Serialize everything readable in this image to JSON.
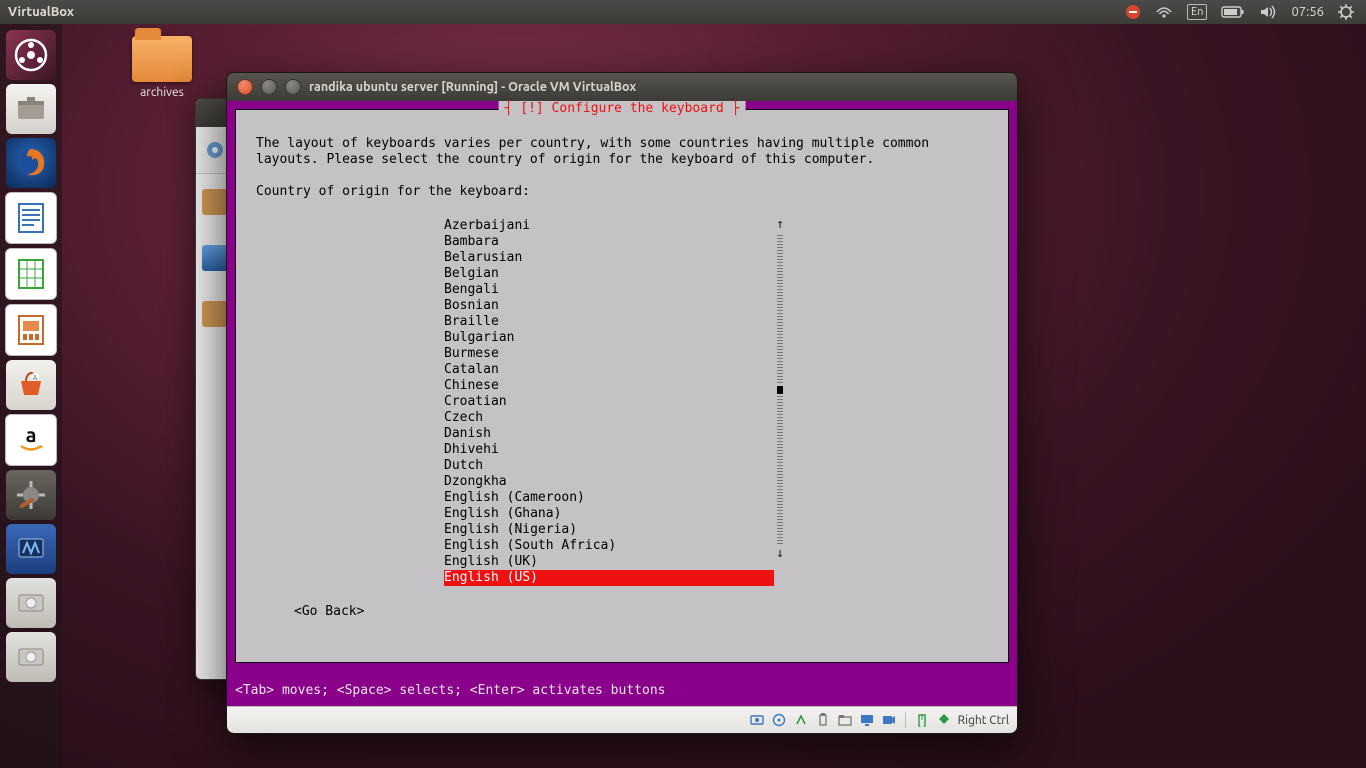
{
  "topbar": {
    "app_title": "VirtualBox",
    "lang": "En",
    "clock": "07:56"
  },
  "desktop": {
    "folder_label": "archives"
  },
  "vm_window": {
    "title": "randika ubuntu server [Running] - Oracle VM VirtualBox",
    "host_key": "Right Ctrl"
  },
  "installer": {
    "dialog_title": "[!] Configure the keyboard",
    "intro": "The layout of keyboards varies per country, with some countries having multiple common\nlayouts. Please select the country of origin for the keyboard of this computer.",
    "prompt": "Country of origin for the keyboard:",
    "items": [
      "Azerbaijani",
      "Bambara",
      "Belarusian",
      "Belgian",
      "Bengali",
      "Bosnian",
      "Braille",
      "Bulgarian",
      "Burmese",
      "Catalan",
      "Chinese",
      "Croatian",
      "Czech",
      "Danish",
      "Dhivehi",
      "Dutch",
      "Dzongkha",
      "English (Cameroon)",
      "English (Ghana)",
      "English (Nigeria)",
      "English (South Africa)",
      "English (UK)",
      "English (US)"
    ],
    "selected_index": 22,
    "go_back": "<Go Back>",
    "help": "<Tab> moves; <Space> selects; <Enter> activates buttons"
  }
}
